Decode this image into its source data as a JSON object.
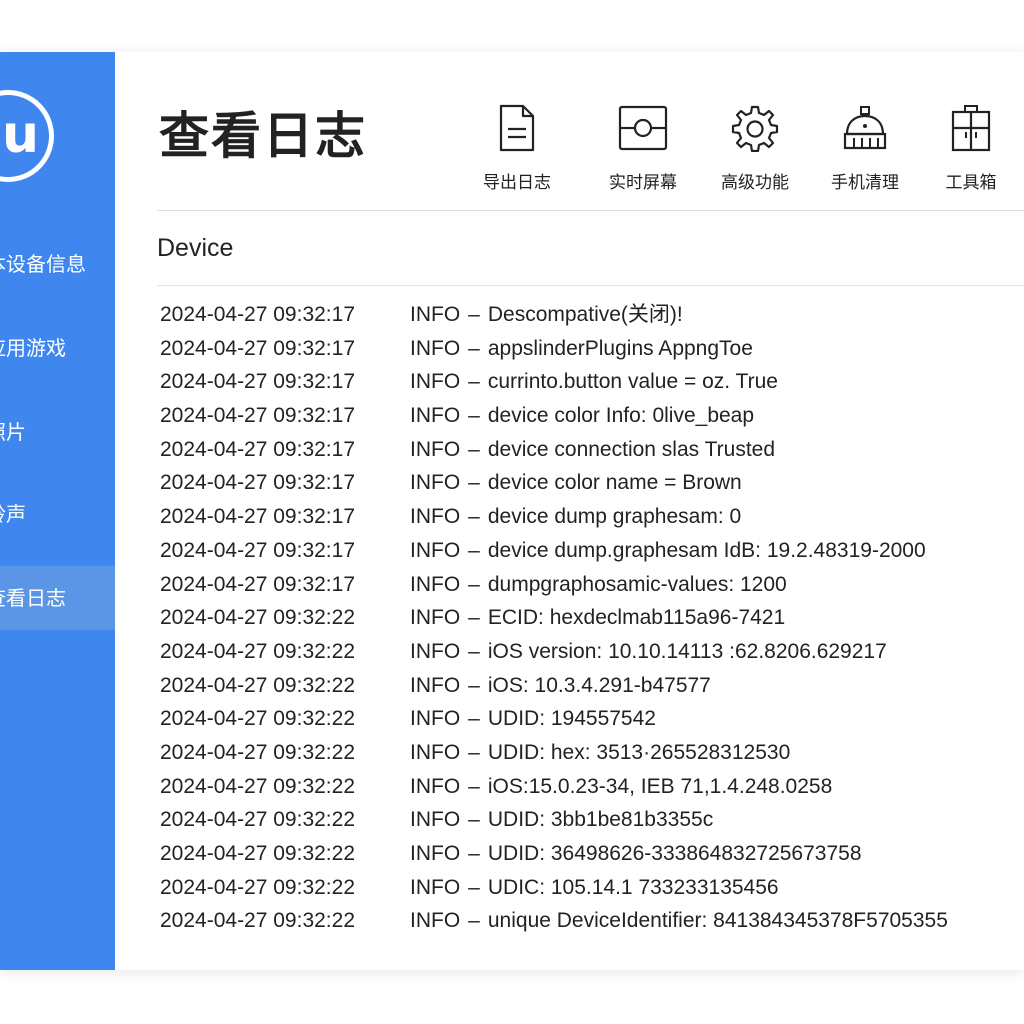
{
  "sidebar": {
    "logo_text": "iu",
    "items": [
      {
        "label": "本设备信息"
      },
      {
        "label": "应用游戏"
      },
      {
        "label": "照片"
      },
      {
        "label": "铃声"
      },
      {
        "label": "查看日志"
      }
    ],
    "active_index": 4
  },
  "header": {
    "title": "查看日志"
  },
  "toolbar": {
    "items": [
      {
        "label": "导出日志",
        "icon": "document-icon"
      },
      {
        "label": "实时屏幕",
        "icon": "screen-icon"
      },
      {
        "label": "高级功能",
        "icon": "gear-icon"
      },
      {
        "label": "手机清理",
        "icon": "cleaner-icon"
      },
      {
        "label": "工具箱",
        "icon": "toolbox-icon"
      }
    ]
  },
  "section": {
    "title": "Device"
  },
  "log": {
    "separator": "–",
    "rows": [
      {
        "time": "2024-04-27 09:32:17",
        "level": "INFO",
        "message": "Descompative(关闭)!"
      },
      {
        "time": "2024-04-27 09:32:17",
        "level": "INFO",
        "message": "appslinderPlugins AppngToe"
      },
      {
        "time": "2024-04-27 09:32:17",
        "level": "INFO",
        "message": "currinto.button value = oz. True"
      },
      {
        "time": "2024-04-27 09:32:17",
        "level": "INFO",
        "message": "device color Info: 0live_beap"
      },
      {
        "time": "2024-04-27 09:32:17",
        "level": "INFO",
        "message": "device connection slas Trusted"
      },
      {
        "time": "2024-04-27 09:32:17",
        "level": "INFO",
        "message": "device color name = Brown"
      },
      {
        "time": "2024-04-27 09:32:17",
        "level": "INFO",
        "message": "device dump graphesam: 0"
      },
      {
        "time": "2024-04-27 09:32:17",
        "level": "INFO",
        "message": "device dump.graphesam IdB: 19.2.48319-2000"
      },
      {
        "time": "2024-04-27 09:32:17",
        "level": "INFO",
        "message": "dumpgraphosamic-values: 1200"
      },
      {
        "time": "2024-04-27 09:32:22",
        "level": "INFO",
        "message": "ECID: hexdeclmab115a96-7421"
      },
      {
        "time": "2024-04-27 09:32:22",
        "level": "INFO",
        "message": "iOS version: 10.10.14113 :62.8206.629217"
      },
      {
        "time": "2024-04-27 09:32:22",
        "level": "INFO",
        "message": "iOS: 10.3.4.291-b47577"
      },
      {
        "time": "2024-04-27 09:32:22",
        "level": "INFO",
        "message": "UDID: 194557542"
      },
      {
        "time": "2024-04-27 09:32:22",
        "level": "INFO",
        "message": "UDID: hex: 3513·265528312530"
      },
      {
        "time": "2024-04-27 09:32:22",
        "level": "INFO",
        "message": "iOS:15.0.23-34, IEB 71,1.4.248.0258"
      },
      {
        "time": "2024-04-27 09:32:22",
        "level": "INFO",
        "message": "UDID: 3bb1be81b3355c"
      },
      {
        "time": "2024-04-27 09:32:22",
        "level": "INFO",
        "message": "UDID: 36498626-333864832725673758"
      },
      {
        "time": "2024-04-27 09:32:22",
        "level": "INFO",
        "message": "UDIC: 105.14.1 733233135456"
      },
      {
        "time": "2024-04-27 09:32:22",
        "level": "INFO",
        "message": "unique  DeviceIdentifier: 841384345378F5705355"
      }
    ]
  },
  "colors": {
    "sidebar": "#3f87ee",
    "sidebar_active": "#5b95e6",
    "text": "#222222"
  }
}
